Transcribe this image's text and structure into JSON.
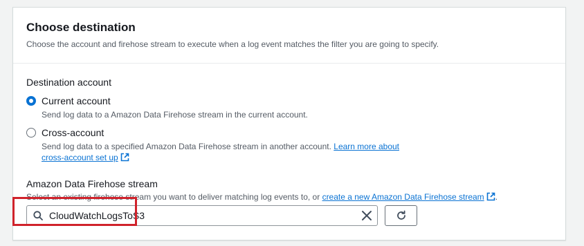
{
  "panel": {
    "title": "Choose destination",
    "description": "Choose the account and firehose stream to execute when a log event matches the filter you are going to specify."
  },
  "destination_account": {
    "label": "Destination account",
    "options": [
      {
        "label": "Current account",
        "description": "Send log data to a Amazon Data Firehose stream in the current account.",
        "selected": true
      },
      {
        "label": "Cross-account",
        "description": "Send log data to a specified Amazon Data Firehose stream in another account.",
        "link_text_line1": "Learn more about",
        "link_text_line2": "cross-account set up",
        "selected": false
      }
    ]
  },
  "firehose_stream": {
    "label": "Amazon Data Firehose stream",
    "description_prefix": "Select an existing firehose stream you want to deliver matching log events to, or",
    "create_link": "create a new Amazon Data Firehose stream",
    "description_suffix": ".",
    "value": "CloudWatchLogsToS3"
  },
  "icons": {
    "search": "search-icon",
    "clear": "close-icon",
    "refresh": "refresh-icon",
    "external": "external-link-icon"
  },
  "colors": {
    "accent": "#0972d3",
    "highlight": "#d0222b"
  }
}
